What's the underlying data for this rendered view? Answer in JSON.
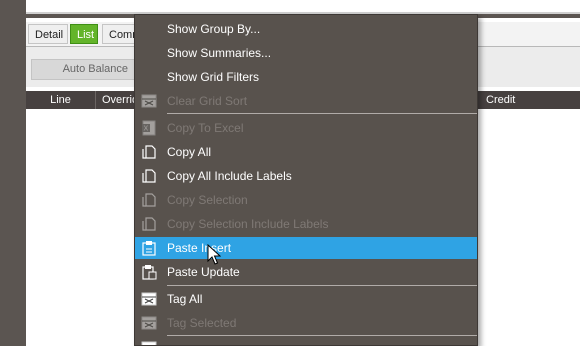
{
  "tabs": {
    "detail": "Detail",
    "list": "List",
    "comm": "Comments"
  },
  "toolbar": {
    "auto_balance": "Auto Balance"
  },
  "grid": {
    "columns": {
      "line": "Line",
      "overr": "Override",
      "credit": "Credit"
    }
  },
  "context_menu": {
    "items": [
      {
        "label": "Show Group By...",
        "enabled": true,
        "icon": null
      },
      {
        "label": "Show Summaries...",
        "enabled": true,
        "icon": null
      },
      {
        "label": "Show Grid Filters",
        "enabled": true,
        "icon": null
      },
      {
        "label": "Clear Grid Sort",
        "enabled": false,
        "icon": "clear-sort-icon"
      },
      {
        "label": "Copy To Excel",
        "enabled": false,
        "icon": "excel-icon"
      },
      {
        "label": "Copy All",
        "enabled": true,
        "icon": "copy-icon"
      },
      {
        "label": "Copy All Include Labels",
        "enabled": true,
        "icon": "copy-icon"
      },
      {
        "label": "Copy Selection",
        "enabled": false,
        "icon": "copy-icon"
      },
      {
        "label": "Copy Selection Include Labels",
        "enabled": false,
        "icon": "copy-icon"
      },
      {
        "label": "Paste Insert",
        "enabled": true,
        "highlighted": true,
        "icon": "paste-icon"
      },
      {
        "label": "Paste Update",
        "enabled": true,
        "icon": "paste-update-icon"
      },
      {
        "label": "Tag All",
        "enabled": true,
        "icon": "tag-icon"
      },
      {
        "label": "Tag Selected",
        "enabled": false,
        "icon": "tag-icon"
      }
    ]
  },
  "colors": {
    "highlight": "#2fa3e4",
    "menu_bg": "#58524d",
    "active_tab": "#63b42a",
    "grid_header": "#474140"
  }
}
